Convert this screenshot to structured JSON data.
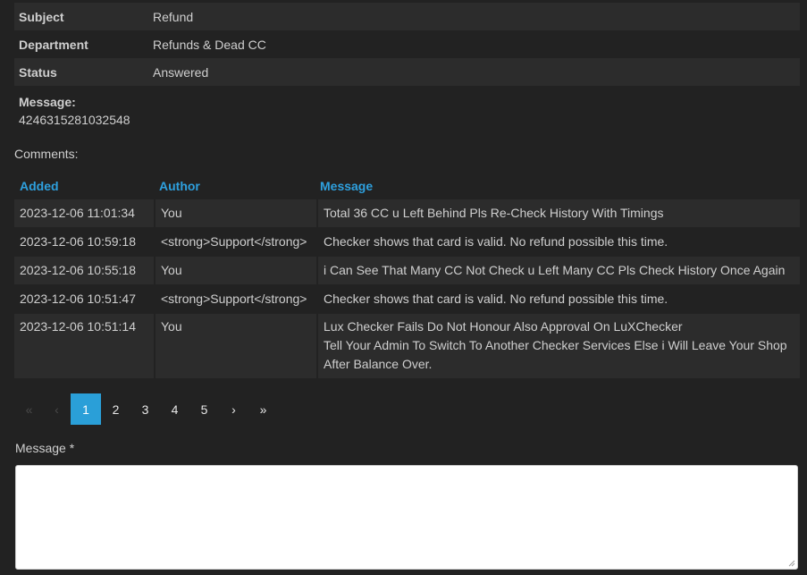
{
  "ticket": {
    "rows": [
      {
        "key": "Subject",
        "value": "Refund"
      },
      {
        "key": "Department",
        "value": "Refunds & Dead CC"
      },
      {
        "key": "Status",
        "value": "Answered"
      }
    ],
    "message_label": "Message:",
    "message_value": "4246315281032548"
  },
  "comments": {
    "label": "Comments:",
    "headers": {
      "added": "Added",
      "author": "Author",
      "message": "Message"
    },
    "rows": [
      {
        "added": "2023-12-06 11:01:34",
        "author": "You",
        "message": [
          "Total 36 CC u Left Behind Pls Re-Check History With Timings"
        ]
      },
      {
        "added": "2023-12-06 10:59:18",
        "author": "<strong>Support</strong>",
        "message": [
          "Checker shows that card is valid. No refund possible this time."
        ]
      },
      {
        "added": "2023-12-06 10:55:18",
        "author": "You",
        "message": [
          "i Can See That Many CC Not Check u Left Many CC Pls Check History Once Again"
        ]
      },
      {
        "added": "2023-12-06 10:51:47",
        "author": "<strong>Support</strong>",
        "message": [
          "Checker shows that card is valid. No refund possible this time."
        ]
      },
      {
        "added": "2023-12-06 10:51:14",
        "author": "You",
        "message": [
          "Lux Checker Fails Do Not Honour Also Approval On LuXChecker",
          "Tell Your Admin To Switch To Another Checker Services Else i Will Leave Your Shop",
          "After Balance Over."
        ]
      }
    ]
  },
  "pagination": {
    "first": "«",
    "prev": "‹",
    "pages": [
      "1",
      "2",
      "3",
      "4",
      "5"
    ],
    "active": "1",
    "next": "›",
    "last": "»"
  },
  "form": {
    "message_label": "Message *",
    "message_value": ""
  },
  "colors": {
    "background": "#222222",
    "stripe": "#2c2c2c",
    "accent": "#2ea0de",
    "active_page": "#2a9fd8"
  }
}
